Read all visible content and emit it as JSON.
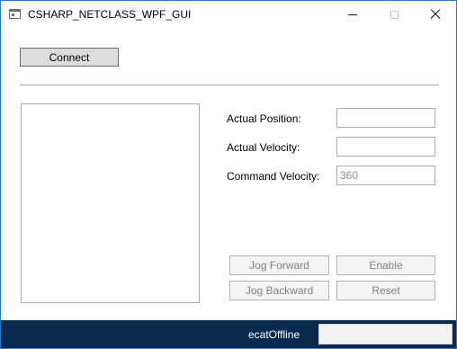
{
  "window": {
    "title": "CSHARP_NETCLASS_WPF_GUI",
    "icon": "app-window-icon"
  },
  "toolbar": {
    "connect_label": "Connect"
  },
  "fields": {
    "actual_position": {
      "label": "Actual Position:",
      "value": ""
    },
    "actual_velocity": {
      "label": "Actual Velocity:",
      "value": ""
    },
    "command_velocity": {
      "label": "Command Velocity:",
      "value": "360"
    }
  },
  "controls": {
    "jog_forward": "Jog Forward",
    "enable": "Enable",
    "jog_backward": "Jog Backward",
    "reset": "Reset"
  },
  "status": {
    "text": "ecatOffline",
    "box_value": ""
  },
  "colors": {
    "status_bar": "#0b2a4f",
    "window_border": "#2b79c9",
    "button_face": "#dddddd",
    "disabled_text": "#838383"
  }
}
